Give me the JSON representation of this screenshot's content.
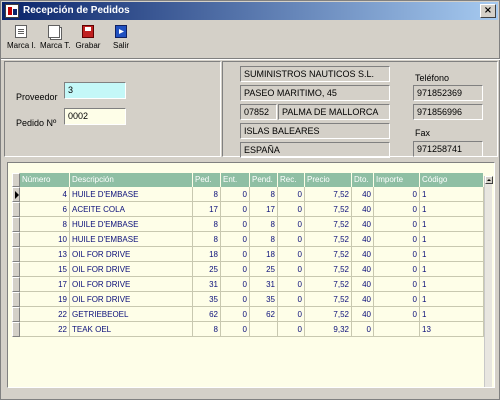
{
  "window": {
    "title": "Recepción de Pedidos"
  },
  "toolbar": {
    "marca_i": "Marca I.",
    "marca_t": "Marca T.",
    "grabar": "Grabar",
    "salir": "Salir"
  },
  "form": {
    "proveedor_label": "Proveedor",
    "proveedor_value": "3",
    "pedido_label": "Pedido Nº",
    "pedido_value": "0002"
  },
  "supplier": {
    "name": "SUMINISTROS NAUTICOS S.L.",
    "address": "PASEO MARITIMO, 45",
    "postal_code": "07852",
    "city": "PALMA DE MALLORCA",
    "region": "ISLAS BALEARES",
    "country": "ESPAÑA",
    "telefono_label": "Teléfono",
    "phone1": "971852369",
    "phone2": "971856996",
    "fax_label": "Fax",
    "fax": "971258741"
  },
  "grid": {
    "headers": [
      "Número",
      "Descripción",
      "Ped.",
      "Ent.",
      "Pend.",
      "Rec.",
      "Precio",
      "Dto.",
      "Importe",
      "Código"
    ],
    "rows": [
      [
        "4",
        "HUILE D'EMBASE",
        "8",
        "0",
        "8",
        "0",
        "7,52",
        "40",
        "0",
        "1"
      ],
      [
        "6",
        "ACEITE COLA",
        "17",
        "0",
        "17",
        "0",
        "7,52",
        "40",
        "0",
        "1"
      ],
      [
        "8",
        "HUILE D'EMBASE",
        "8",
        "0",
        "8",
        "0",
        "7,52",
        "40",
        "0",
        "1"
      ],
      [
        "10",
        "HUILE D'EMBASE",
        "8",
        "0",
        "8",
        "0",
        "7,52",
        "40",
        "0",
        "1"
      ],
      [
        "13",
        "OIL FOR DRIVE",
        "18",
        "0",
        "18",
        "0",
        "7,52",
        "40",
        "0",
        "1"
      ],
      [
        "15",
        "OIL FOR DRIVE",
        "25",
        "0",
        "25",
        "0",
        "7,52",
        "40",
        "0",
        "1"
      ],
      [
        "17",
        "OIL FOR DRIVE",
        "31",
        "0",
        "31",
        "0",
        "7,52",
        "40",
        "0",
        "1"
      ],
      [
        "19",
        "OIL FOR DRIVE",
        "35",
        "0",
        "35",
        "0",
        "7,52",
        "40",
        "0",
        "1"
      ],
      [
        "22",
        "GETRIEBEOEL",
        "62",
        "0",
        "62",
        "0",
        "7,52",
        "40",
        "0",
        "1"
      ],
      [
        "22",
        "TEAK OEL",
        "8",
        "0",
        "",
        "0",
        "9,32",
        "0",
        "",
        "13"
      ]
    ]
  }
}
